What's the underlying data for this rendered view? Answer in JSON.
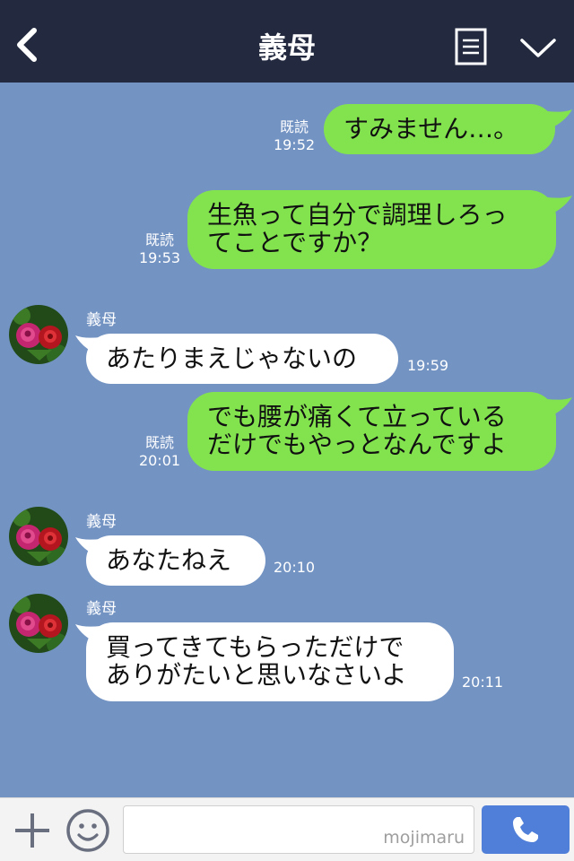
{
  "header": {
    "title": "義母",
    "back_icon": "chevron-left-icon",
    "menu_icon": "menu-icon",
    "more_icon": "chevron-down-icon"
  },
  "messages": [
    {
      "direction": "out",
      "text_lines": [
        "すみません…。"
      ],
      "read": "既読",
      "time": "19:52"
    },
    {
      "direction": "out",
      "text_lines": [
        "生魚って自分で調理しろっ",
        "てことですか？"
      ],
      "read": "既読",
      "time": "19:53"
    },
    {
      "direction": "in",
      "sender": "義母",
      "text_lines": [
        "あたりまえじゃないの"
      ],
      "time": "19:59"
    },
    {
      "direction": "out",
      "text_lines": [
        "でも腰が痛くて立っている",
        "だけでもやっとなんですよ"
      ],
      "read": "既読",
      "time": "20:01"
    },
    {
      "direction": "in",
      "sender": "義母",
      "text_lines": [
        "あなたねえ"
      ],
      "time": "20:10"
    },
    {
      "direction": "in",
      "sender": "義母",
      "text_lines": [
        "買ってきてもらっただけで",
        "ありがたいと思いなさいよ"
      ],
      "time": "20:11"
    }
  ],
  "footer": {
    "input_value": "",
    "watermark": "mojimaru",
    "plus_icon": "plus-icon",
    "emoji_icon": "emoji-icon",
    "call_icon": "phone-icon"
  },
  "colors": {
    "header_bg": "#232a40",
    "chat_bg": "#7393c3",
    "outgoing_bubble": "#83e34f",
    "incoming_bubble": "#ffffff",
    "call_button": "#4f7fd8"
  }
}
